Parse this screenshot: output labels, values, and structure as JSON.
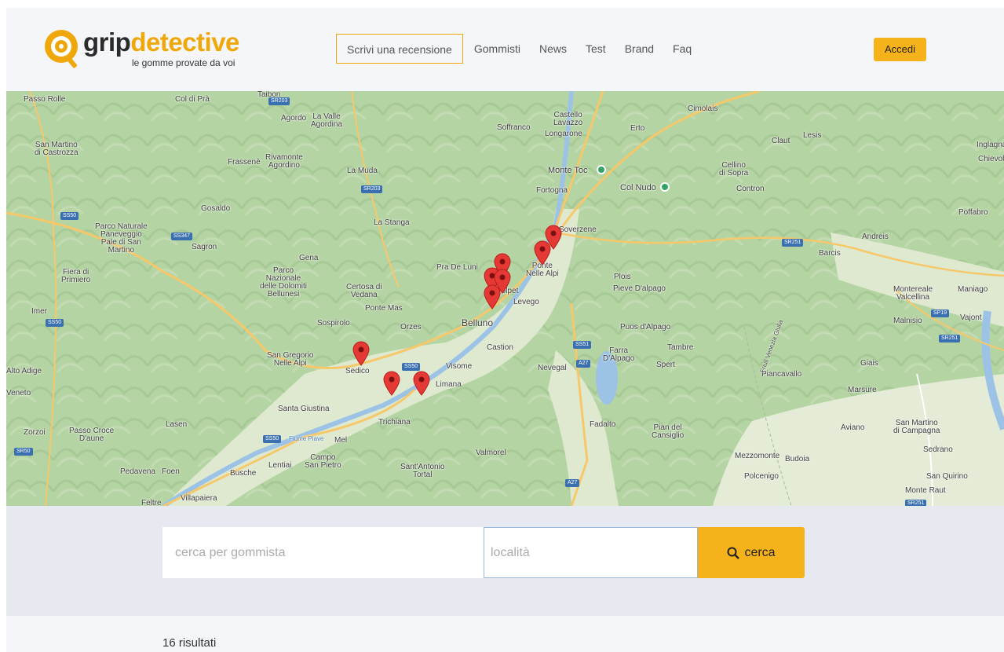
{
  "brand": {
    "name_part1": "grip",
    "name_part2": "detective",
    "tagline": "le gomme provate da voi",
    "accent": "#f0a70a"
  },
  "nav": {
    "items": [
      {
        "label": "Scrivi una recensione"
      },
      {
        "label": "Gommisti"
      },
      {
        "label": "News"
      },
      {
        "label": "Test"
      },
      {
        "label": "Brand"
      },
      {
        "label": "Faq"
      }
    ],
    "login_label": "Accedi"
  },
  "map": {
    "labels": [
      "Passo Rolle",
      "Col di Prà",
      "Taibon",
      "Agordo",
      "La Valle\nAgordina",
      "San Martino\ndi Castrozza",
      "Frassenè",
      "Rivamonte\nAgordino",
      "La Muda",
      "Soffranco",
      "Castello\nLavazzo",
      "Longarone",
      "Erto",
      "Cimolais",
      "Claut",
      "Lesis",
      "Inglagna",
      "Chievolis",
      "Monte Toc",
      "Col Nudo",
      "Fortogna",
      "Cellino\ndi Sopra",
      "Contron",
      "Gosaldo",
      "La Stanga",
      "Poffabro",
      "Parco Naturale\nPaneveggio\nPale di San\nMartino",
      "Sagron",
      "Soverzene",
      "Andreis",
      "Barcis",
      "Gena",
      "Parco\nNazionale\ndelle Dolomiti\nBellunesi",
      "Pra De Luni",
      "Ponte\nNelle Alpi",
      "Fiera di\nPrimiero",
      "Certosa di\nVedana",
      "Polpet",
      "Plois",
      "Pieve D'alpago",
      "Ponte Mas",
      "Levego",
      "Montereale\nValcellina",
      "Maniago",
      "Imer",
      "Sospirolo",
      "Orzes",
      "Belluno",
      "Puos d'Alpago",
      "Vajont",
      "Malnisio",
      "Castion",
      "Farra\nD'Alpago",
      "Tambre",
      "San Gregorio\nNelle Alpi",
      "Sedico",
      "Visome",
      "Spert",
      "Giais",
      "Limana",
      "Nevegal",
      "Piancavallo",
      "Alto Adige",
      "Marsure",
      "Veneto",
      "Santa Giustina",
      "Lasen",
      "Trichiana",
      "Fadalto",
      "Pian del\nCansiglio",
      "Aviano",
      "San Martino\ndi Campagna",
      "Zorzoi",
      "Passo Croce\nD'aune",
      "Mel",
      "Sedrano",
      "Campo\nSan Pietro",
      "Lentiai",
      "Valmorel",
      "Mezzomonte",
      "Budoia",
      "Pedavena",
      "Foen",
      "Busche",
      "Sant'Antonio\nTortal",
      "Polcenigo",
      "San Quirino",
      "Monte Raut",
      "Feltre",
      "Villapaiera",
      "Fiume Piave",
      "Friuli Venezia Giulia"
    ],
    "roads": [
      "SR203",
      "SS50",
      "SS347",
      "SR203",
      "SR251",
      "SS50",
      "SS51",
      "A27",
      "SS50",
      "SR50",
      "SS50",
      "SP19",
      "SR251",
      "A27",
      "SR251"
    ]
  },
  "search": {
    "shop_placeholder": "cerca per gommista",
    "location_placeholder": "località",
    "button_label": "cerca"
  },
  "results": {
    "count_text": "16 risultati"
  }
}
